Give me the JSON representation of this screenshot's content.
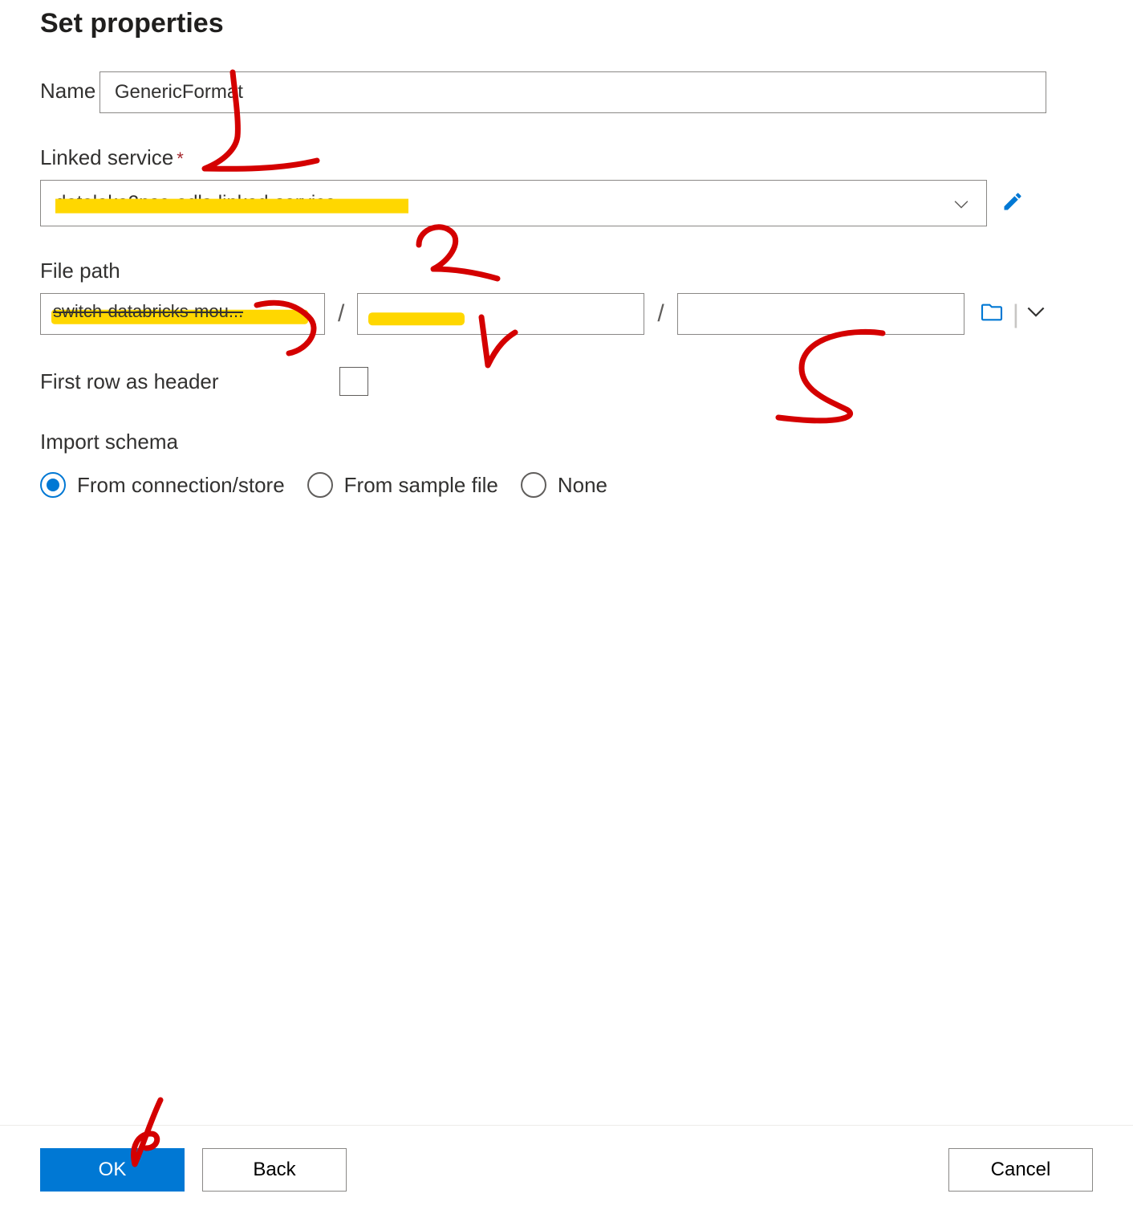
{
  "title": "Set properties",
  "name": {
    "label": "Name",
    "value": "GenericFormat"
  },
  "linked_service": {
    "label": "Linked service",
    "required": true,
    "value_redacted": "datalake2psa-adls-linked-service"
  },
  "file_path": {
    "label": "File path",
    "container_redacted": "switch-databricks-mou...",
    "directory_redacted": "",
    "file_value": ""
  },
  "first_row_header": {
    "label": "First row as header",
    "checked": false
  },
  "import_schema": {
    "label": "Import schema",
    "options": [
      {
        "label": "From connection/store",
        "selected": true
      },
      {
        "label": "From sample file",
        "selected": false
      },
      {
        "label": "None",
        "selected": false
      }
    ]
  },
  "buttons": {
    "ok": "OK",
    "back": "Back",
    "cancel": "Cancel"
  },
  "annotations": {
    "nums": [
      "1",
      "2",
      "3",
      "4",
      "5",
      "6"
    ]
  }
}
